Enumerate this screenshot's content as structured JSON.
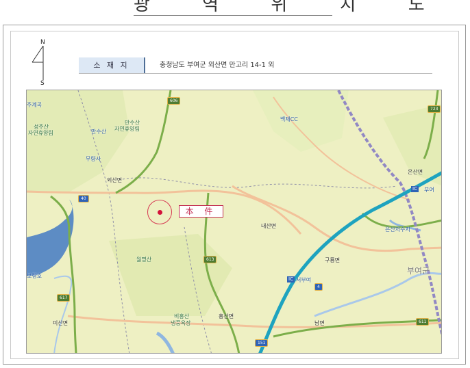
{
  "document": {
    "title": "광 역 위 치 도",
    "location_label": "소 재 지",
    "location_value": "충청남도 부여군 외산면 만고리 14-1 외",
    "north_n": "N",
    "north_s": "S"
  },
  "map": {
    "highlight_label": "本 件",
    "colors": {
      "background": "#eef0c3",
      "site_marker": "#d3133a",
      "expressway": "#1ea3bf",
      "national_road": "#7cae4a"
    },
    "places": [
      {
        "key": "p1",
        "text": "주계곡"
      },
      {
        "key": "p2",
        "text": "성주산"
      },
      {
        "key": "p3",
        "text": "자연휴양림"
      },
      {
        "key": "p4",
        "text": "만수산"
      },
      {
        "key": "p5",
        "text": "자연휴양림"
      },
      {
        "key": "p6",
        "text": "만수산"
      },
      {
        "key": "p7",
        "text": "무량사"
      },
      {
        "key": "p8",
        "text": "외산면"
      },
      {
        "key": "p9",
        "text": "백제CC"
      },
      {
        "key": "p10",
        "text": "은산면"
      },
      {
        "key": "p11",
        "text": "부여"
      },
      {
        "key": "p12",
        "text": "은산저수지"
      },
      {
        "key": "p13",
        "text": "내산면"
      },
      {
        "key": "p14",
        "text": "월명산"
      },
      {
        "key": "p15",
        "text": "구룡면"
      },
      {
        "key": "p16",
        "text": "부여군"
      },
      {
        "key": "p17",
        "text": "서부여"
      },
      {
        "key": "p18",
        "text": "보령호"
      },
      {
        "key": "p19",
        "text": "미산면"
      },
      {
        "key": "p20",
        "text": "비홍산"
      },
      {
        "key": "p21",
        "text": "냉풍욕장"
      },
      {
        "key": "p22",
        "text": "홍산면"
      },
      {
        "key": "p23",
        "text": "남면"
      }
    ],
    "routes": [
      "606",
      "723",
      "613",
      "617",
      "611",
      "151",
      "4",
      "40"
    ],
    "ic_labels": [
      "IC",
      "IC"
    ]
  }
}
